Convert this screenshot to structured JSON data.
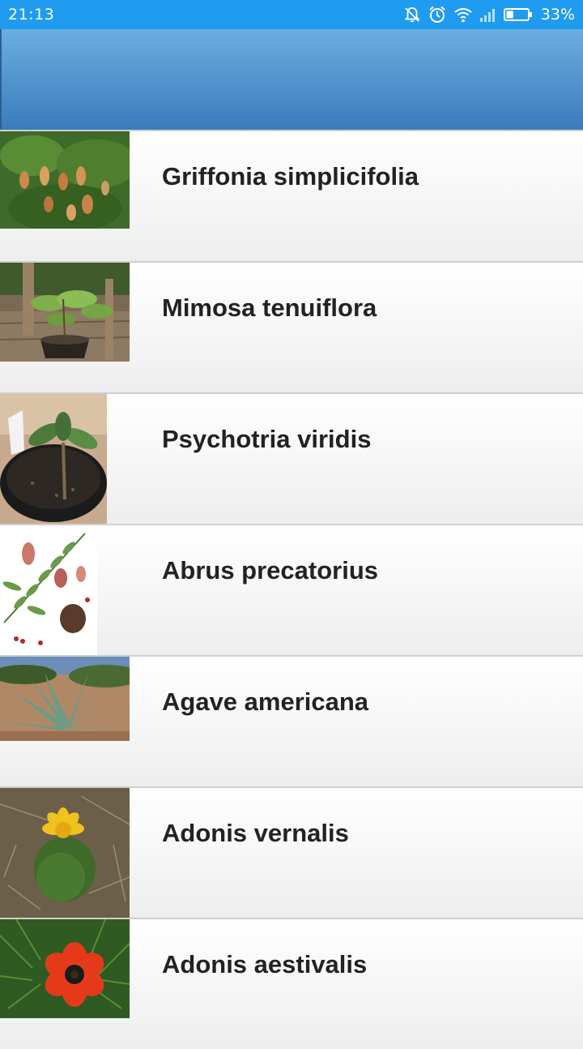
{
  "status_bar": {
    "time": "21:13",
    "battery_percent": "33%",
    "battery_level": 0.33,
    "icons": [
      "bell-off-icon",
      "alarm-icon",
      "wifi-icon",
      "signal-icon",
      "battery-icon"
    ]
  },
  "app_bar": {
    "gradient_top": "#6aaee0",
    "gradient_bottom": "#3b7cbc"
  },
  "plants": [
    {
      "name": "Griffonia simplicifolia",
      "image": "griffonia-thumbnail"
    },
    {
      "name": "Mimosa tenuiflora",
      "image": "mimosa-thumbnail"
    },
    {
      "name": "Psychotria viridis",
      "image": "psychotria-thumbnail"
    },
    {
      "name": "Abrus precatorius",
      "image": "abrus-thumbnail"
    },
    {
      "name": "Agave americana",
      "image": "agave-thumbnail"
    },
    {
      "name": "Adonis vernalis",
      "image": "adonis-vernalis-thumbnail"
    },
    {
      "name": "Adonis aestivalis",
      "image": "adonis-aestivalis-thumbnail"
    }
  ]
}
